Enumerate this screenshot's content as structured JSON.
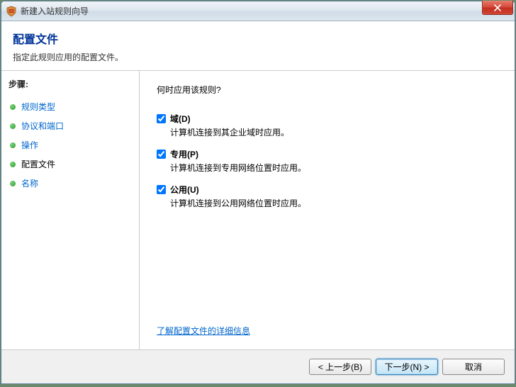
{
  "window": {
    "title": "新建入站规则向导"
  },
  "header": {
    "title": "配置文件",
    "subtitle": "指定此规则应用的配置文件。"
  },
  "steps": {
    "title": "步骤:",
    "items": [
      {
        "label": "规则类型",
        "isLink": true,
        "isCurrent": false
      },
      {
        "label": "协议和端口",
        "isLink": true,
        "isCurrent": false
      },
      {
        "label": "操作",
        "isLink": true,
        "isCurrent": false
      },
      {
        "label": "配置文件",
        "isLink": false,
        "isCurrent": true
      },
      {
        "label": "名称",
        "isLink": true,
        "isCurrent": false
      }
    ]
  },
  "content": {
    "question": "何时应用该规则?",
    "options": [
      {
        "label": "域(D)",
        "description": "计算机连接到其企业域时应用。",
        "checked": true
      },
      {
        "label": "专用(P)",
        "description": "计算机连接到专用网络位置时应用。",
        "checked": true
      },
      {
        "label": "公用(U)",
        "description": "计算机连接到公用网络位置时应用。",
        "checked": true
      }
    ],
    "learnMore": "了解配置文件的详细信息"
  },
  "footer": {
    "back": "< 上一步(B)",
    "next": "下一步(N) >",
    "cancel": "取消"
  }
}
